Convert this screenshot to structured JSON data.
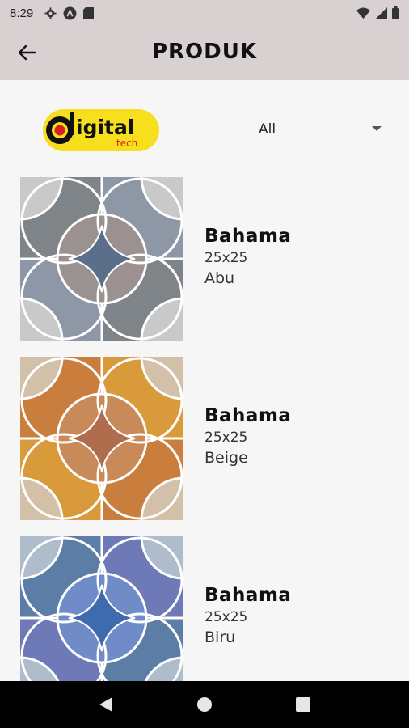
{
  "status_bar": {
    "time": "8:29",
    "left_icons": [
      "gear-icon",
      "a-circle-icon",
      "sd-card-icon"
    ],
    "right_icons": [
      "wifi-icon",
      "signal-icon",
      "battery-icon"
    ]
  },
  "app_bar": {
    "title": "PRODUK",
    "back_icon": "arrow-left-icon"
  },
  "filter": {
    "logo_text_main": "igital",
    "logo_text_sub": "tech",
    "selected": "All"
  },
  "products": [
    {
      "name": "Bahama",
      "size": "25x25",
      "color": "Abu",
      "palette": {
        "bg": "#d3d3d3",
        "outer": "#7f8489",
        "outer2": "#8d97a5",
        "petal": "#6f7378",
        "petal2": "#9a9190",
        "center": "#5b6f8a",
        "corner": "#c9c9c9"
      }
    },
    {
      "name": "Bahama",
      "size": "25x25",
      "color": "Beige",
      "palette": {
        "bg": "#d9c6aa",
        "outer": "#c97e3e",
        "outer2": "#d99a3c",
        "petal": "#a5653a",
        "petal2": "#c98a5a",
        "center": "#b06d4e",
        "corner": "#d2c1a8"
      }
    },
    {
      "name": "Bahama",
      "size": "25x25",
      "color": "Biru",
      "palette": {
        "bg": "#bcc6d2",
        "outer": "#5c7ea6",
        "outer2": "#6e79b8",
        "petal": "#3f5f86",
        "petal2": "#6f8cc8",
        "center": "#3f6aae",
        "corner": "#aebccb"
      }
    }
  ],
  "nav_bar": {
    "icons": [
      "back-triangle-icon",
      "home-circle-icon",
      "recents-square-icon"
    ]
  }
}
